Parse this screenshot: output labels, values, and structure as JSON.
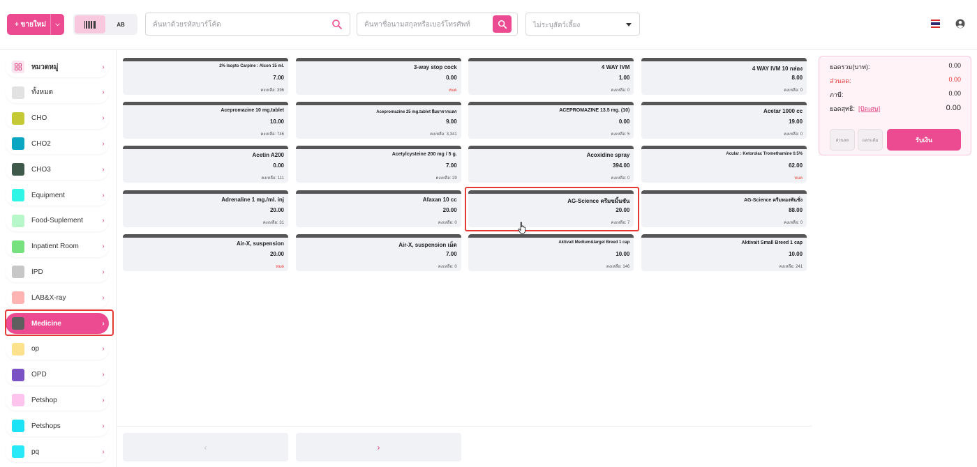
{
  "topbar": {
    "new_sale_label": "+ ขายใหม่",
    "mode_barcode_icon": "barcode-icon",
    "mode_ab_label": "AB",
    "barcode_search_placeholder": "ค้นหาด้วยรหัสบาร์โค้ด",
    "customer_search_placeholder": "ค้นหาชื่อนามสกุลหรือเบอร์โทรศัพท์",
    "pet_select_value": "ไม่ระบุสัตว์เลี้ยง",
    "flag_icon": "thai-flag-icon",
    "user_icon": "user-circle-icon",
    "accent_color": "#ec4b92"
  },
  "sidebar": {
    "items": [
      {
        "label": "หมวดหมู่",
        "color": "#fde6ef",
        "icon": "grid-icon"
      },
      {
        "label": "ทั้งหมด",
        "color": "#e2e2e2"
      },
      {
        "label": "CHO",
        "color": "#c5c936"
      },
      {
        "label": "CHO2",
        "color": "#0aa6c2"
      },
      {
        "label": "CHO3",
        "color": "#3f5a4a"
      },
      {
        "label": "Equipment",
        "color": "#2ef5e6"
      },
      {
        "label": "Food-Suplement",
        "color": "#b7f7c9"
      },
      {
        "label": "Inpatient Room",
        "color": "#77e07f"
      },
      {
        "label": "IPD",
        "color": "#c7c7c7"
      },
      {
        "label": "LAB&X-ray",
        "color": "#ffb4b4"
      },
      {
        "label": "Medicine",
        "color": "#5f5f5f"
      },
      {
        "label": "op",
        "color": "#fde28e"
      },
      {
        "label": "OPD",
        "color": "#7b52c4"
      },
      {
        "label": "Petshop",
        "color": "#fec4ee"
      },
      {
        "label": "Petshops",
        "color": "#1ee2f5"
      },
      {
        "label": "pq",
        "color": "#27e9f7"
      }
    ],
    "active_label": "Medicine"
  },
  "products": [
    {
      "name": "2% Isopto Carpine : Alcon 15 ml.",
      "price": "7.00",
      "stock": "คงเหลือ: 396"
    },
    {
      "name": "3-way stop cock",
      "price": "0.00",
      "stock": "หมด"
    },
    {
      "name": "4 WAY IVM",
      "price": "1.00",
      "stock": "คงเหลือ: 0"
    },
    {
      "name": "4 WAY IVM 10 กล่อง",
      "price": "8.00",
      "stock": "คงเหลือ: 0"
    },
    {
      "name": "Acepromazine 10 mg.tablet",
      "price": "10.00",
      "stock": "คงเหลือ: 746"
    },
    {
      "name": "Acepromazine 25 mg.tablet ยืมยาจากแลก",
      "price": "9.00",
      "stock": "คงเหลือ: 3,341"
    },
    {
      "name": "ACEPROMAZINE 13.5 mg. (10)",
      "price": "0.00",
      "stock": "คงเหลือ: 5"
    },
    {
      "name": "Acetar 1000 cc",
      "price": "19.00",
      "stock": "คงเหลือ: 0"
    },
    {
      "name": "Acetin A200",
      "price": "0.00",
      "stock": "คงเหลือ: 111"
    },
    {
      "name": "Acetylcysteine 200 mg / 5 g.",
      "price": "7.00",
      "stock": "คงเหลือ: 29"
    },
    {
      "name": "Acoxidine spray",
      "price": "394.00",
      "stock": "คงเหลือ: 0"
    },
    {
      "name": "Acular : Ketorolac Tromethamine 0.5%",
      "price": "62.00",
      "stock": "หมด"
    },
    {
      "name": "Adrenaline 1 mg./ml. inj",
      "price": "20.00",
      "stock": "คงเหลือ: 31"
    },
    {
      "name": "Afaxan 10 cc",
      "price": "20.00",
      "stock": "คงเหลือ: 0"
    },
    {
      "name": "AG-Science ครีมขมิ้นชัน",
      "price": "20.00",
      "stock": "คงเหลือ: 7"
    },
    {
      "name": "AG-Science ครีมทองพันชั่ง",
      "price": "88.00",
      "stock": "คงเหลือ: 0"
    },
    {
      "name": "Air-X, suspension",
      "price": "20.00",
      "stock": "หมด"
    },
    {
      "name": "Air-X, suspension เม็ด",
      "price": "7.00",
      "stock": "คงเหลือ: 0"
    },
    {
      "name": "Aktivait Medium&largel Breed 1 cap",
      "price": "10.00",
      "stock": "คงเหลือ: 146"
    },
    {
      "name": "Aktivait Small Breed 1 cap",
      "price": "10.00",
      "stock": "คงเหลือ: 241"
    }
  ],
  "pager": {
    "prev_icon": "chevron-left-icon",
    "prev_glyph": "‹",
    "next_icon": "chevron-right-icon",
    "next_glyph": "›"
  },
  "summary": {
    "total_label": "ยอดรวม(บาท):",
    "total_value": "0.00",
    "discount_label": "ส่วนลด:",
    "discount_value": "0.00",
    "tax_label": "ภาษี:",
    "tax_value": "0.00",
    "net_label": "ยอดสุทธิ:",
    "round_label": "[ปัดเศษ]",
    "net_value": "0.00",
    "discount_btn_label": "ส่วนลด",
    "points_btn_label": "แลกแต้ม",
    "pay_btn_label": "รับเงิน"
  }
}
